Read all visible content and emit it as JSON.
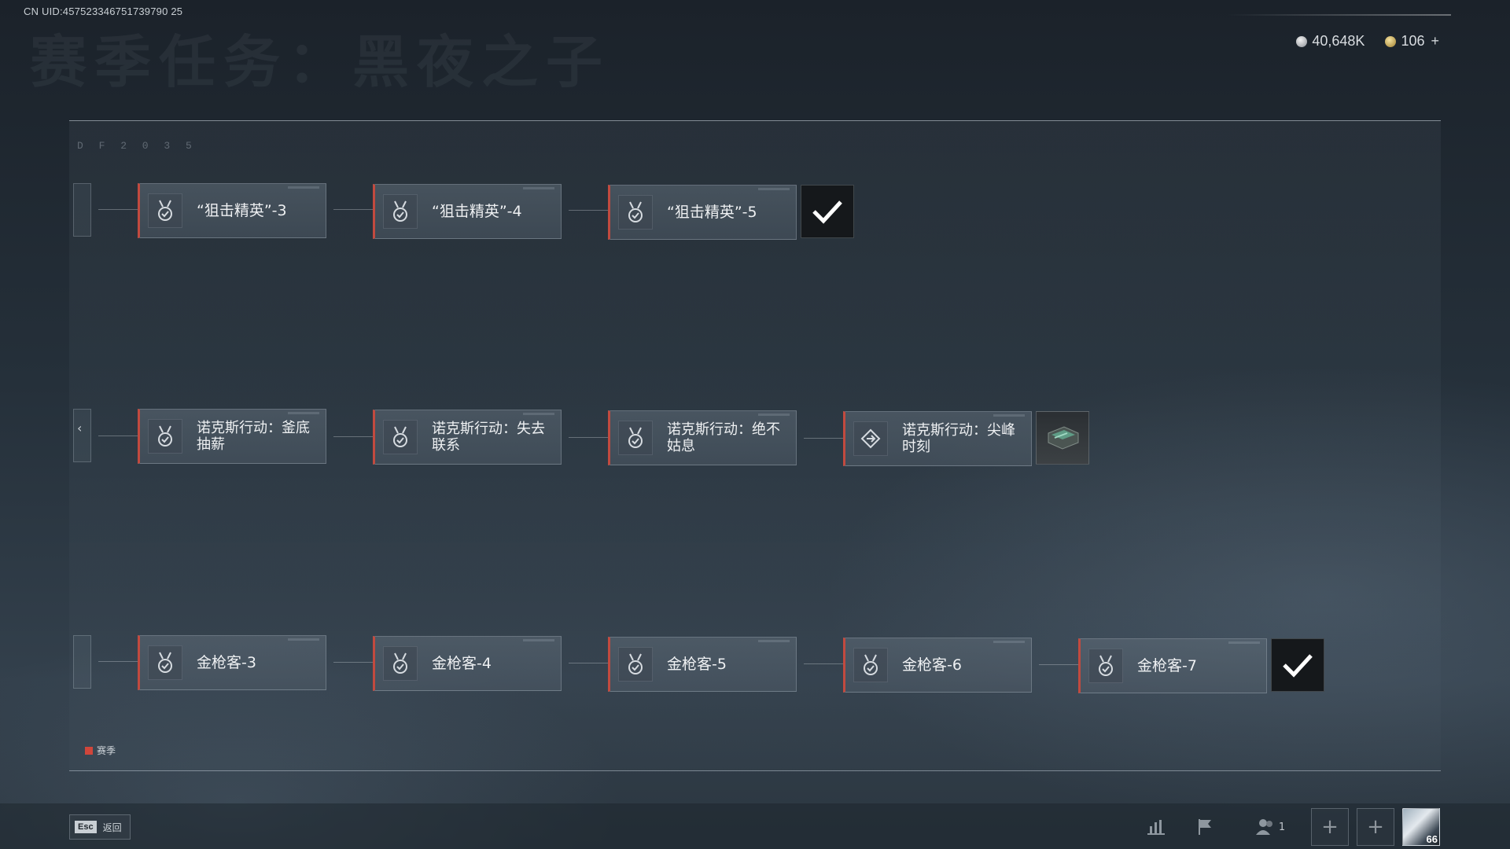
{
  "uid": "CN UID:457523346751739790 25",
  "page_title": "赛季任务：黑夜之子",
  "currency": [
    {
      "icon": "silver-coin-icon",
      "value": "40,648K",
      "plus": ""
    },
    {
      "icon": "gold-coin-icon",
      "value": "106",
      "plus": "+"
    }
  ],
  "board_tag": "D F 2 0 3 5",
  "rows": [
    {
      "tasks": [
        {
          "label": "“狙击精英”-3",
          "icon": "medal-check-icon"
        },
        {
          "label": "“狙击精英”-4",
          "icon": "medal-check-icon"
        },
        {
          "label": "“狙击精英”-5",
          "icon": "medal-check-icon"
        }
      ],
      "reward": {
        "type": "completed",
        "icon": "checkmark-icon"
      }
    },
    {
      "tasks": [
        {
          "label": "诺克斯行动：釜底抽薪",
          "icon": "medal-check-icon"
        },
        {
          "label": "诺克斯行动：失去联系",
          "icon": "medal-check-icon"
        },
        {
          "label": "诺克斯行动：绝不姑息",
          "icon": "medal-check-icon"
        },
        {
          "label": "诺克斯行动：尖峰时刻",
          "icon": "waypoint-icon"
        }
      ],
      "reward": {
        "type": "item",
        "icon": "armor-plate-icon"
      }
    },
    {
      "tasks": [
        {
          "label": "金枪客-3",
          "icon": "medal-check-icon"
        },
        {
          "label": "金枪客-4",
          "icon": "medal-check-icon"
        },
        {
          "label": "金枪客-5",
          "icon": "medal-check-icon"
        },
        {
          "label": "金枪客-6",
          "icon": "medal-check-icon"
        },
        {
          "label": "金枪客-7",
          "icon": "medal-check-icon"
        }
      ],
      "reward": {
        "type": "completed",
        "icon": "checkmark-icon"
      }
    }
  ],
  "legend": {
    "label": "赛季",
    "color": "#d0463b"
  },
  "bottom_bar": {
    "esc_key": "Esc",
    "esc_label": "返回",
    "friend_count": "1",
    "level": "66"
  },
  "colors": {
    "accent": "#c24a3f"
  }
}
